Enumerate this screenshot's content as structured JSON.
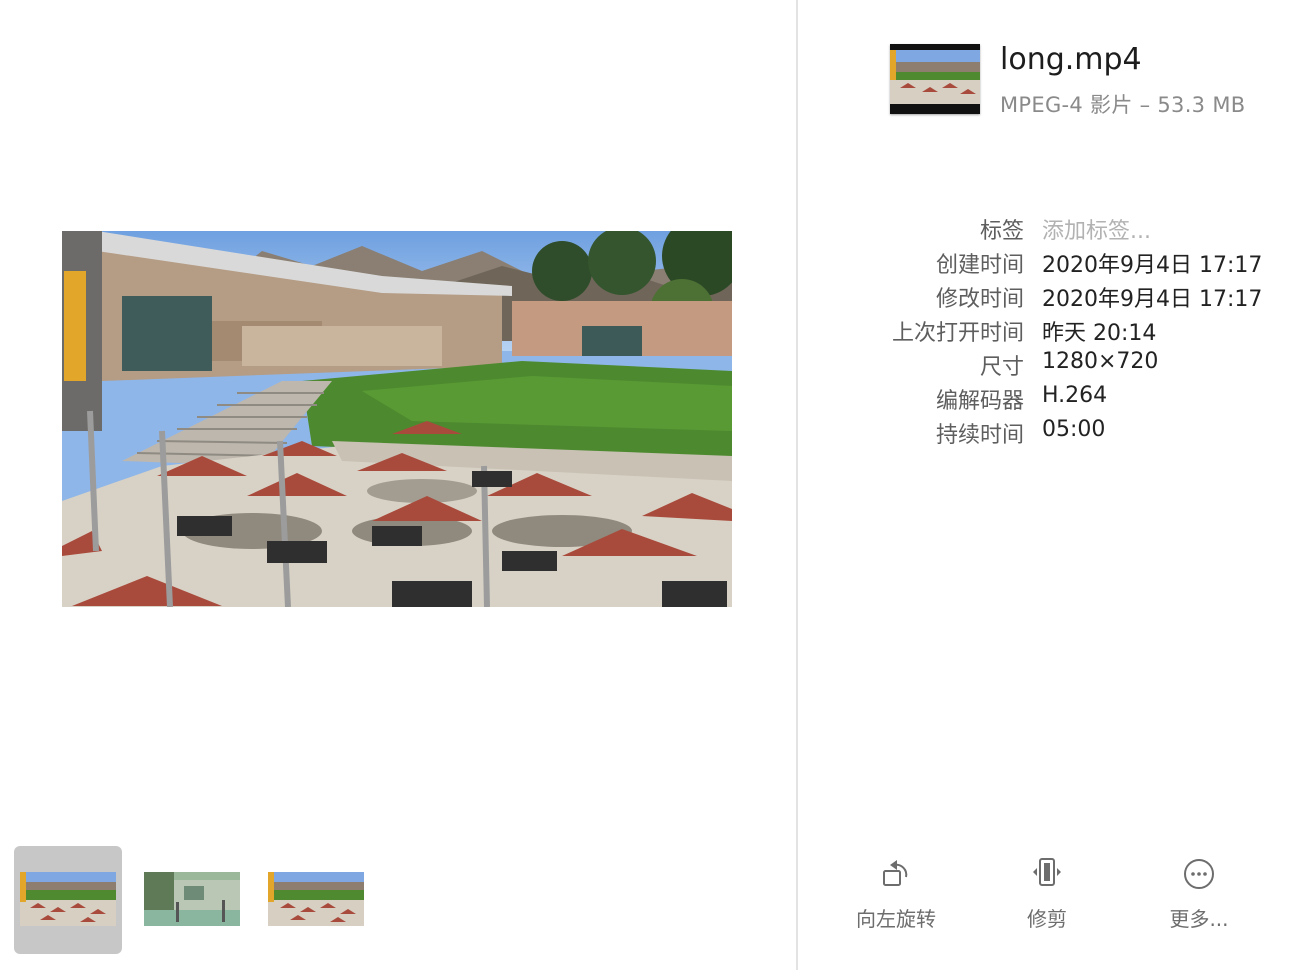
{
  "file": {
    "name": "long.mp4",
    "kind": "MPEG-4 影片 – 53.3 MB",
    "icon": "video-thumbnail-icon"
  },
  "info": [
    {
      "label": "标签",
      "value": "添加标签..."
    },
    {
      "label": "创建时间",
      "value": "2020年9月4日 17:17"
    },
    {
      "label": "修改时间",
      "value": "2020年9月4日 17:17"
    },
    {
      "label": "上次打开时间",
      "value": "昨天 20:14"
    },
    {
      "label": "尺寸",
      "value": "1280×720"
    },
    {
      "label": "编解码器",
      "value": "H.264"
    },
    {
      "label": "持续时间",
      "value": "05:00"
    }
  ],
  "actions": [
    {
      "label": "向左旋转",
      "icon": "rotate-left-icon"
    },
    {
      "label": "修剪",
      "icon": "trim-icon"
    },
    {
      "label": "更多...",
      "icon": "more-icon"
    }
  ],
  "thumbnails": {
    "count": 3,
    "selected_index": 0
  },
  "colors": {
    "selected_thumb_bg": "#c7c7c7",
    "divider": "#e3e3e3",
    "umbrella": "#a94b3c"
  }
}
